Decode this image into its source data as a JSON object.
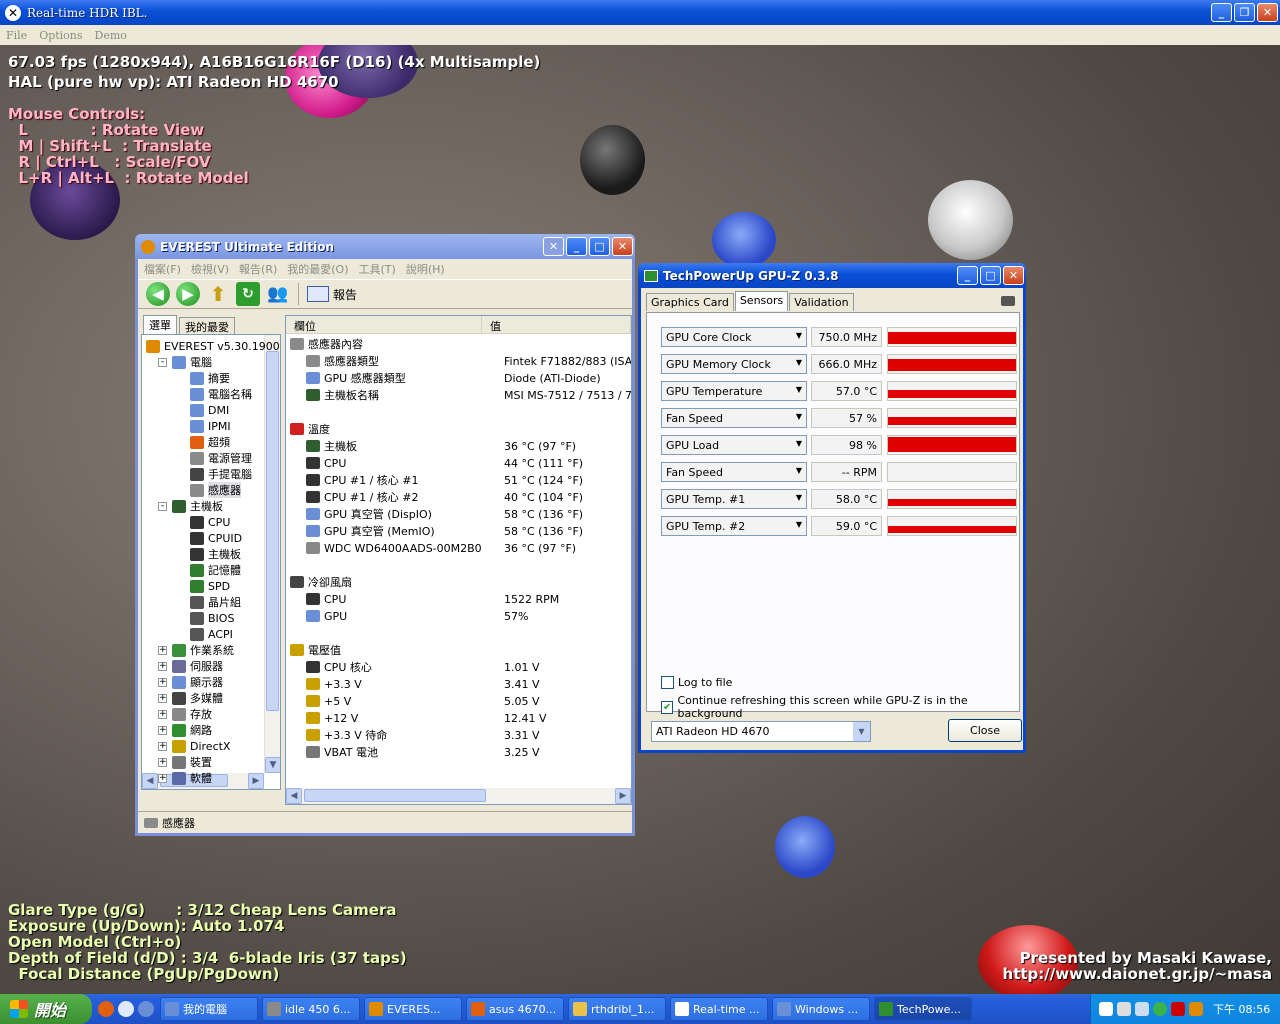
{
  "hdr_window": {
    "title": "Real-time HDR IBL.",
    "menu": [
      "File",
      "Options",
      "Demo"
    ]
  },
  "overlay": {
    "fps_line": "67.03 fps (1280x944), A16B16G16R16F (D16) (4x Multisample)",
    "hal_line": "HAL (pure hw vp): ATI Radeon HD 4670",
    "mouse_title": "Mouse Controls:",
    "mouse_controls": [
      "  L            : Rotate View",
      "  M | Shift+L  : Translate",
      "  R | Ctrl+L   : Scale/FOV",
      "  L+R | Alt+L  : Rotate Model"
    ],
    "bottom_lines": [
      "Glare Type (g/G)      : 3/12 Cheap Lens Camera",
      "Exposure (Up/Down): Auto 1.074",
      "Open Model (Ctrl+o)",
      "Depth of Field (d/D) : 3/4  6-blade Iris (37 taps)",
      "  Focal Distance (PgUp/PgDown)"
    ],
    "credit_1": "Presented by Masaki Kawase,",
    "credit_2": "http://www.daionet.gr.jp/~masa"
  },
  "everest": {
    "title": "EVEREST Ultimate Edition",
    "menu": [
      "檔案(F)",
      "檢視(V)",
      "報告(R)",
      "我的最愛(O)",
      "工具(T)",
      "說明(H)"
    ],
    "report_label": "報告",
    "tabs": [
      "選單",
      "我的最愛"
    ],
    "tree": [
      {
        "label": "EVEREST v5.30.1900",
        "level": 0,
        "exp": "",
        "icon": "everest-icon",
        "color": "#e08a00"
      },
      {
        "label": "電腦",
        "level": 1,
        "exp": "-",
        "icon": "computer-icon",
        "color": "#6b8fd6"
      },
      {
        "label": "摘要",
        "level": 2,
        "exp": "",
        "icon": "computer-icon",
        "color": "#6b8fd6"
      },
      {
        "label": "電腦名稱",
        "level": 2,
        "exp": "",
        "icon": "computer-icon",
        "color": "#6b8fd6"
      },
      {
        "label": "DMI",
        "level": 2,
        "exp": "",
        "icon": "computer-icon",
        "color": "#6b8fd6"
      },
      {
        "label": "IPMI",
        "level": 2,
        "exp": "",
        "icon": "computer-icon",
        "color": "#6b8fd6"
      },
      {
        "label": "超頻",
        "level": 2,
        "exp": "",
        "icon": "flame-icon",
        "color": "#e06010"
      },
      {
        "label": "電源管理",
        "level": 2,
        "exp": "",
        "icon": "power-icon",
        "color": "#8a8a8a"
      },
      {
        "label": "手提電腦",
        "level": 2,
        "exp": "",
        "icon": "laptop-icon",
        "color": "#444"
      },
      {
        "label": "感應器",
        "level": 2,
        "exp": "",
        "icon": "sensor-icon",
        "color": "#8a8a8a",
        "selected": true
      },
      {
        "label": "主機板",
        "level": 1,
        "exp": "-",
        "icon": "motherboard-icon",
        "color": "#2f5f2f"
      },
      {
        "label": "CPU",
        "level": 2,
        "exp": "",
        "icon": "cpu-icon",
        "color": "#333"
      },
      {
        "label": "CPUID",
        "level": 2,
        "exp": "",
        "icon": "cpu-icon",
        "color": "#333"
      },
      {
        "label": "主機板",
        "level": 2,
        "exp": "",
        "icon": "motherboard-icon",
        "color": "#333"
      },
      {
        "label": "記憶體",
        "level": 2,
        "exp": "",
        "icon": "memory-icon",
        "color": "#2f7f2f"
      },
      {
        "label": "SPD",
        "level": 2,
        "exp": "",
        "icon": "memory-icon",
        "color": "#2f7f2f"
      },
      {
        "label": "晶片組",
        "level": 2,
        "exp": "",
        "icon": "chipset-icon",
        "color": "#555"
      },
      {
        "label": "BIOS",
        "level": 2,
        "exp": "",
        "icon": "bios-icon",
        "color": "#555"
      },
      {
        "label": "ACPI",
        "level": 2,
        "exp": "",
        "icon": "acpi-icon",
        "color": "#555"
      },
      {
        "label": "作業系統",
        "level": 1,
        "exp": "+",
        "icon": "windows-icon",
        "color": "#3a8f3a"
      },
      {
        "label": "伺服器",
        "level": 1,
        "exp": "+",
        "icon": "server-icon",
        "color": "#6b6b9a"
      },
      {
        "label": "顯示器",
        "level": 1,
        "exp": "+",
        "icon": "display-icon",
        "color": "#6b8fd6"
      },
      {
        "label": "多媒體",
        "level": 1,
        "exp": "+",
        "icon": "multimedia-icon",
        "color": "#444"
      },
      {
        "label": "存放",
        "level": 1,
        "exp": "+",
        "icon": "storage-icon",
        "color": "#888"
      },
      {
        "label": "網路",
        "level": 1,
        "exp": "+",
        "icon": "network-icon",
        "color": "#2f8f2f"
      },
      {
        "label": "DirectX",
        "level": 1,
        "exp": "+",
        "icon": "directx-icon",
        "color": "#c8a000"
      },
      {
        "label": "裝置",
        "level": 1,
        "exp": "+",
        "icon": "devices-icon",
        "color": "#777"
      },
      {
        "label": "軟體",
        "level": 1,
        "exp": "+",
        "icon": "software-icon",
        "color": "#5a6aa8"
      }
    ],
    "columns": [
      "欄位",
      "值"
    ],
    "sections": [
      {
        "title": "感應器內容",
        "icon": "sensor-icon",
        "rows": [
          {
            "field": "感應器類型",
            "value": "Fintek F71882/883  (ISA A00h)",
            "icon": "sensor-icon"
          },
          {
            "field": "GPU 感應器類型",
            "value": "Diode  (ATI-Diode)",
            "icon": "gpu-icon"
          },
          {
            "field": "主機板名稱",
            "value": "MSI MS-7512 / 7513 / 7514 / 7",
            "icon": "motherboard-icon"
          }
        ]
      },
      {
        "title": "溫度",
        "icon": "thermometer-icon",
        "rows": [
          {
            "field": "主機板",
            "value": "36 °C  (97 °F)",
            "icon": "motherboard-icon"
          },
          {
            "field": "CPU",
            "value": "44 °C  (111 °F)",
            "icon": "cpu-icon"
          },
          {
            "field": "CPU #1 / 核心 #1",
            "value": "51 °C  (124 °F)",
            "icon": "cpu-icon"
          },
          {
            "field": "CPU #1 / 核心 #2",
            "value": "40 °C  (104 °F)",
            "icon": "cpu-icon"
          },
          {
            "field": "GPU 真空管 (DispIO)",
            "value": "58 °C  (136 °F)",
            "icon": "gpu-icon"
          },
          {
            "field": "GPU 真空管 (MemIO)",
            "value": "58 °C  (136 °F)",
            "icon": "gpu-icon"
          },
          {
            "field": "WDC WD6400AADS-00M2B0",
            "value": "36 °C  (97 °F)",
            "icon": "disk-icon"
          }
        ]
      },
      {
        "title": "冷卻風扇",
        "icon": "fan-icon",
        "rows": [
          {
            "field": "CPU",
            "value": "1522 RPM",
            "icon": "cpu-icon"
          },
          {
            "field": "GPU",
            "value": "57%",
            "icon": "gpu-icon"
          }
        ]
      },
      {
        "title": "電壓值",
        "icon": "voltage-icon",
        "rows": [
          {
            "field": "CPU 核心",
            "value": "1.01 V",
            "icon": "cpu-icon"
          },
          {
            "field": "+3.3 V",
            "value": "3.41 V",
            "icon": "voltage-icon"
          },
          {
            "field": "+5 V",
            "value": "5.05 V",
            "icon": "voltage-icon"
          },
          {
            "field": "+12 V",
            "value": "12.41 V",
            "icon": "voltage-icon"
          },
          {
            "field": "+3.3 V 待命",
            "value": "3.31 V",
            "icon": "voltage-icon"
          },
          {
            "field": "VBAT 電池",
            "value": "3.25 V",
            "icon": "battery-icon"
          }
        ]
      }
    ],
    "status": "感應器"
  },
  "gpuz": {
    "title": "TechPowerUp GPU-Z 0.3.8",
    "tabs": [
      "Graphics Card",
      "Sensors",
      "Validation"
    ],
    "active_tab": "Sensors",
    "sensors": [
      {
        "name": "GPU Core Clock",
        "value": "750.0 MHz",
        "level": 0.72
      },
      {
        "name": "GPU Memory Clock",
        "value": "666.0 MHz",
        "level": 0.72
      },
      {
        "name": "GPU Temperature",
        "value": "57.0 °C",
        "level": 0.5
      },
      {
        "name": "Fan Speed",
        "value": "57 %",
        "level": 0.5
      },
      {
        "name": "GPU Load",
        "value": "98 %",
        "level": 0.95
      },
      {
        "name": "Fan Speed",
        "value": "-- RPM",
        "level": 0
      },
      {
        "name": "GPU Temp. #1",
        "value": "58.0 °C",
        "level": 0.45
      },
      {
        "name": "GPU Temp. #2",
        "value": "59.0 °C",
        "level": 0.45
      }
    ],
    "log_to_file": "Log to file",
    "log_checked": false,
    "continue_refresh": "Continue refreshing this screen while GPU-Z is in the background",
    "continue_checked": true,
    "card": "ATI Radeon HD 4670",
    "close_label": "Close"
  },
  "taskbar": {
    "start": "開始",
    "tasks": [
      {
        "label": "我的電腦",
        "color": "#6b8fd6",
        "active": false
      },
      {
        "label": "idle 450 6...",
        "color": "#8a8a8a",
        "active": false
      },
      {
        "label": "EVERES...",
        "color": "#e08a00",
        "active": false
      },
      {
        "label": "asus 4670...",
        "color": "#e06010",
        "active": false
      },
      {
        "label": "rthdribl_1...",
        "color": "#e8c24a",
        "active": false
      },
      {
        "label": "Real-time ...",
        "color": "#fff",
        "active": false
      },
      {
        "label": "Windows ...",
        "color": "#6b8fd6",
        "active": false
      },
      {
        "label": "TechPowe...",
        "color": "#2f8f2f",
        "active": true
      }
    ],
    "clock": "下午 08:56"
  }
}
